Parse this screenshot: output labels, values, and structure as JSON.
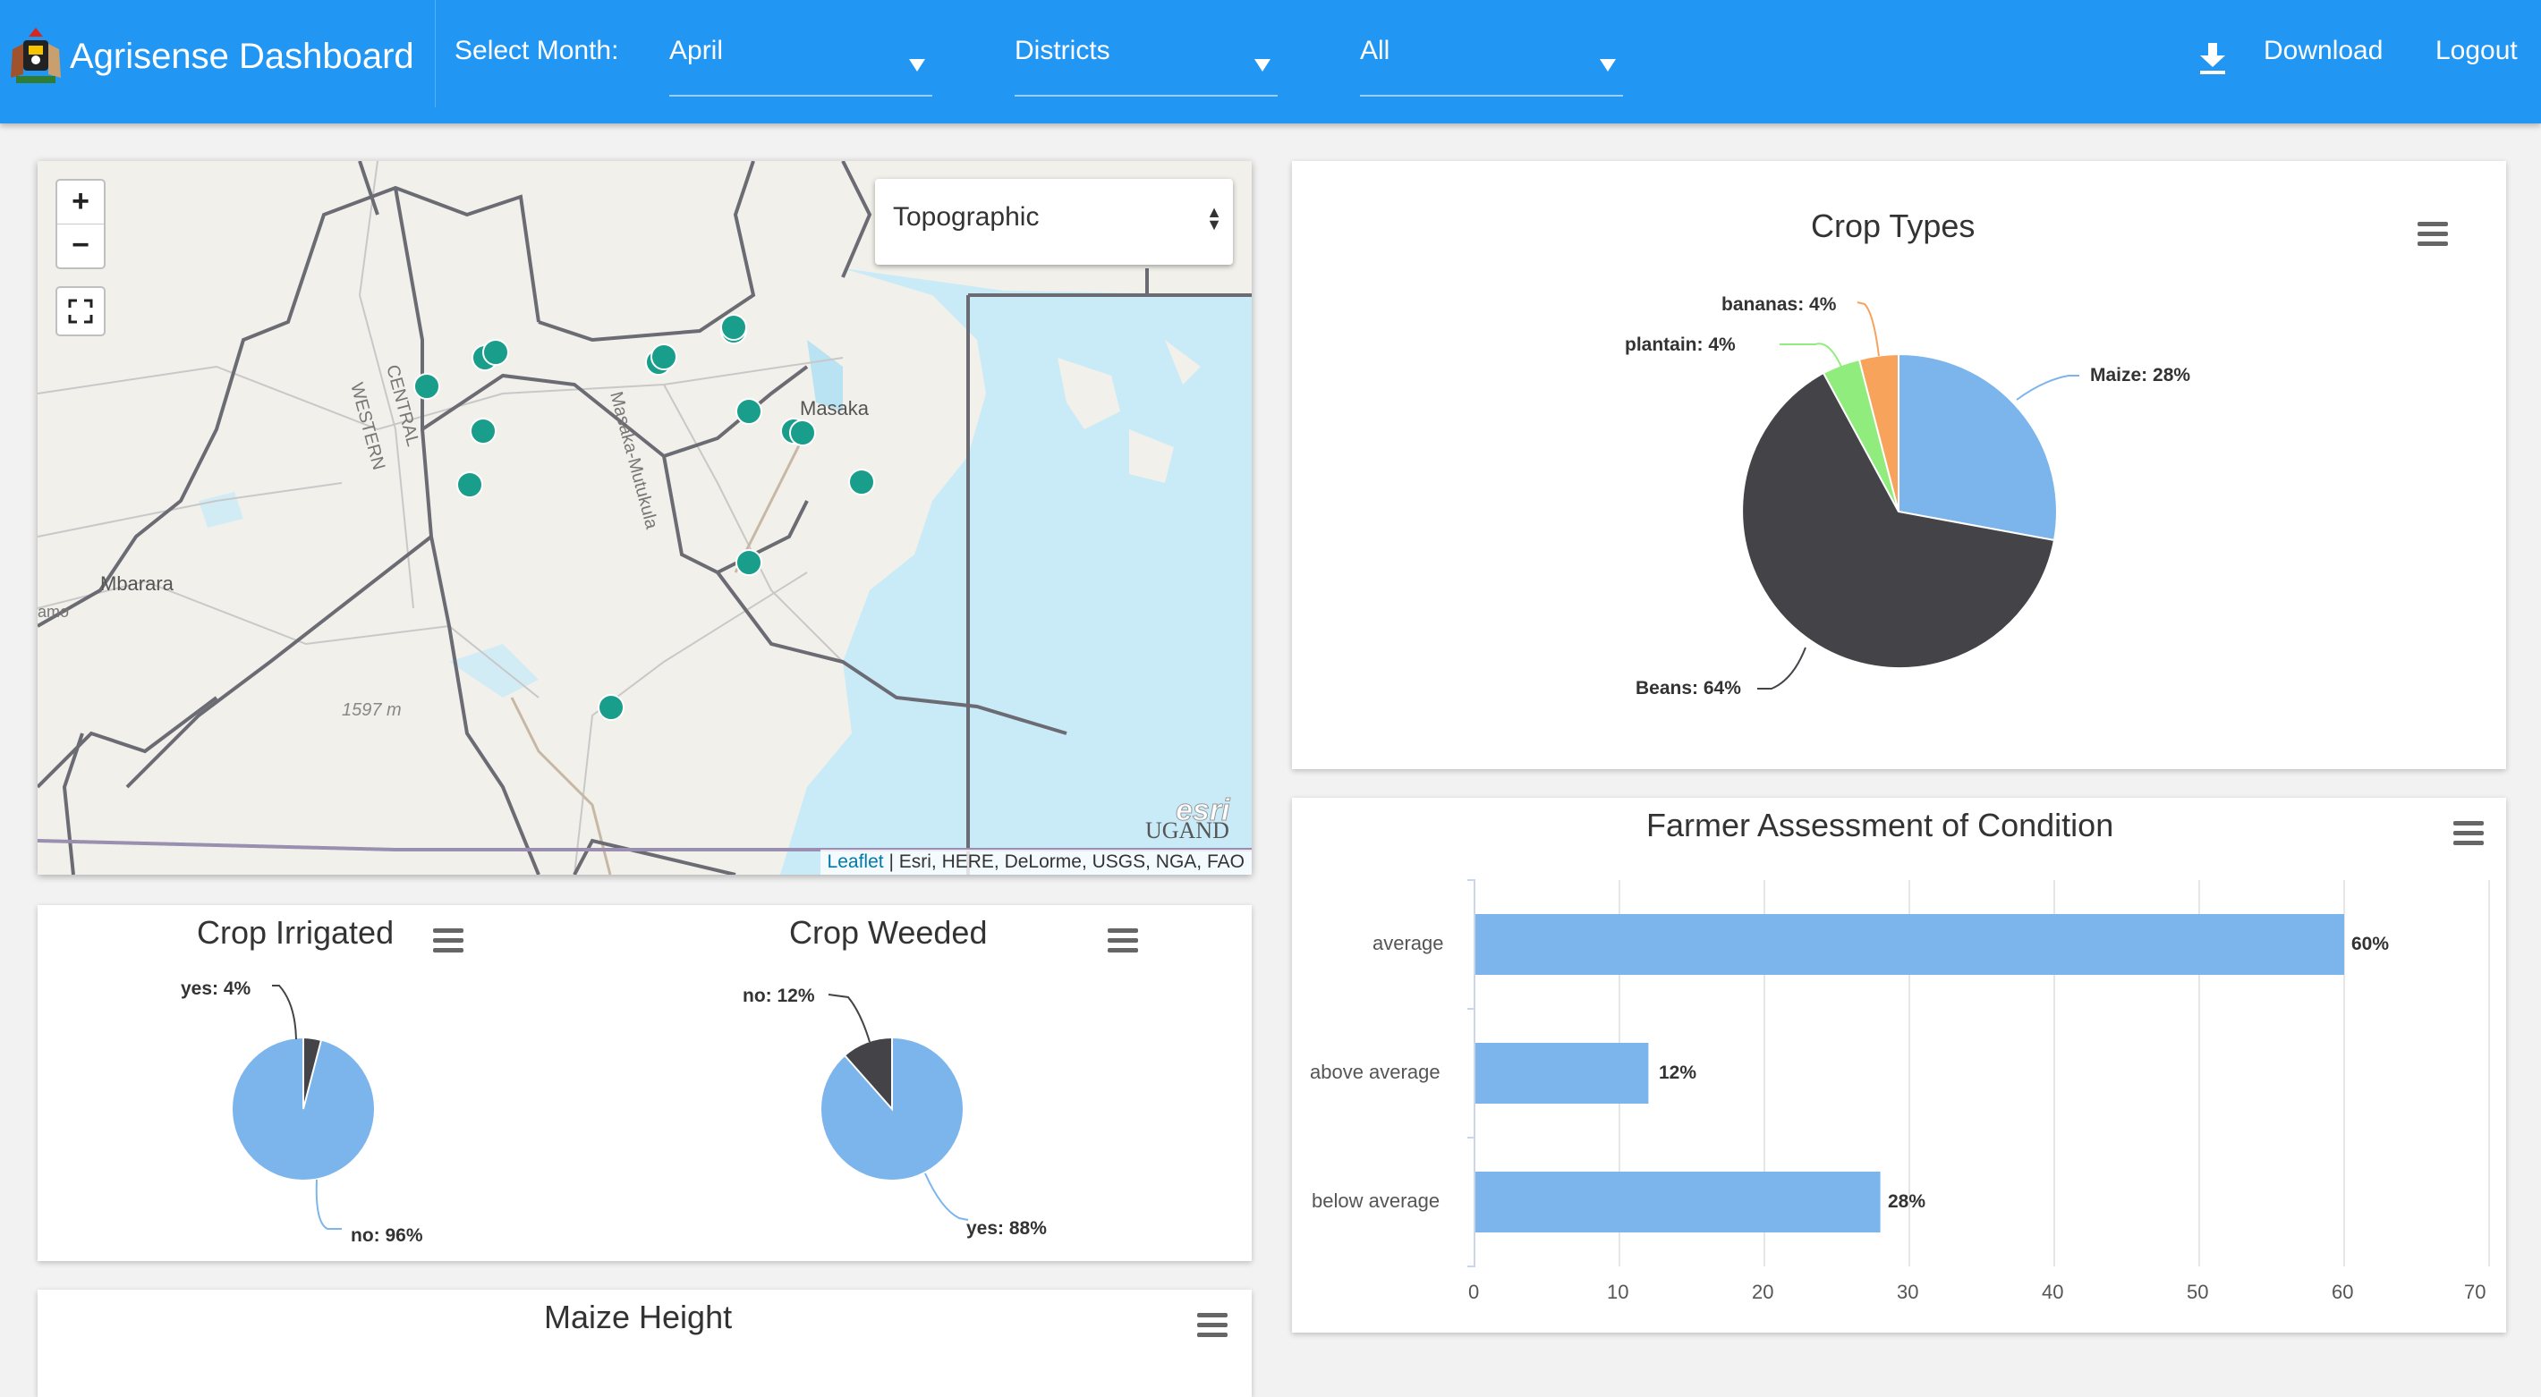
{
  "header": {
    "title": "Agrisense Dashboard",
    "month_label": "Select Month:",
    "month_value": "April",
    "district_value": "Districts",
    "filter_value": "All",
    "download_label": "Download",
    "logout_label": "Logout",
    "brand_color": "#2196f3"
  },
  "map": {
    "layer_select": "Topographic",
    "zoom_in": "+",
    "zoom_out": "−",
    "attribution_link": "Leaflet",
    "attribution_text": " | Esri, HERE, DeLorme, USGS, NGA, FAO",
    "places": {
      "masaka": "Masaka",
      "mbarara": "Mbarara",
      "western": "WESTERN",
      "central": "CENTRAL",
      "elevation": "1597 m",
      "road": "Masaka-Mutukula",
      "country": "UGAND",
      "amo": "amo",
      "esri": "esri"
    },
    "marker_color": "#1a9e8c"
  },
  "crop_types": {
    "title": "Crop Types",
    "labels": {
      "maize": "Maize: 28%",
      "beans": "Beans: 64%",
      "plantain": "plantain: 4%",
      "bananas": "bananas: 4%"
    }
  },
  "crop_irrigated": {
    "title": "Crop Irrigated",
    "labels": {
      "yes": "yes: 4%",
      "no": "no: 96%"
    }
  },
  "crop_weeded": {
    "title": "Crop Weeded",
    "labels": {
      "no": "no: 12%",
      "yes": "yes: 88%"
    }
  },
  "farmer_assessment": {
    "title": "Farmer Assessment of Condition",
    "labels": {
      "average": "60%",
      "above": "12%",
      "below": "28%"
    },
    "categories": {
      "average": "average",
      "above": "above average",
      "below": "below average"
    },
    "ticks": [
      "0",
      "10",
      "20",
      "30",
      "40",
      "50",
      "60",
      "70"
    ]
  },
  "maize_height": {
    "title": "Maize Height"
  },
  "chart_data": [
    {
      "type": "pie",
      "title": "Crop Types",
      "series": [
        {
          "values": [
            {
              "name": "Maize",
              "value": 28,
              "color": "#7cb5ec"
            },
            {
              "name": "Beans",
              "value": 64,
              "color": "#434348"
            },
            {
              "name": "plantain",
              "value": 4,
              "color": "#90ed7d"
            },
            {
              "name": "bananas",
              "value": 4,
              "color": "#f7a35c"
            }
          ]
        }
      ]
    },
    {
      "type": "pie",
      "title": "Crop Irrigated",
      "series": [
        {
          "values": [
            {
              "name": "yes",
              "value": 4,
              "color": "#434348"
            },
            {
              "name": "no",
              "value": 96,
              "color": "#7cb5ec"
            }
          ]
        }
      ]
    },
    {
      "type": "pie",
      "title": "Crop Weeded",
      "series": [
        {
          "values": [
            {
              "name": "no",
              "value": 12,
              "color": "#434348"
            },
            {
              "name": "yes",
              "value": 88,
              "color": "#7cb5ec"
            }
          ]
        }
      ]
    },
    {
      "type": "bar",
      "title": "Farmer Assessment of Condition",
      "orientation": "horizontal",
      "categories": [
        "average",
        "above average",
        "below average"
      ],
      "values": [
        60,
        12,
        28
      ],
      "value_suffix": "%",
      "xlim": [
        0,
        70
      ],
      "grid": true,
      "color": "#7cb5ec"
    }
  ]
}
